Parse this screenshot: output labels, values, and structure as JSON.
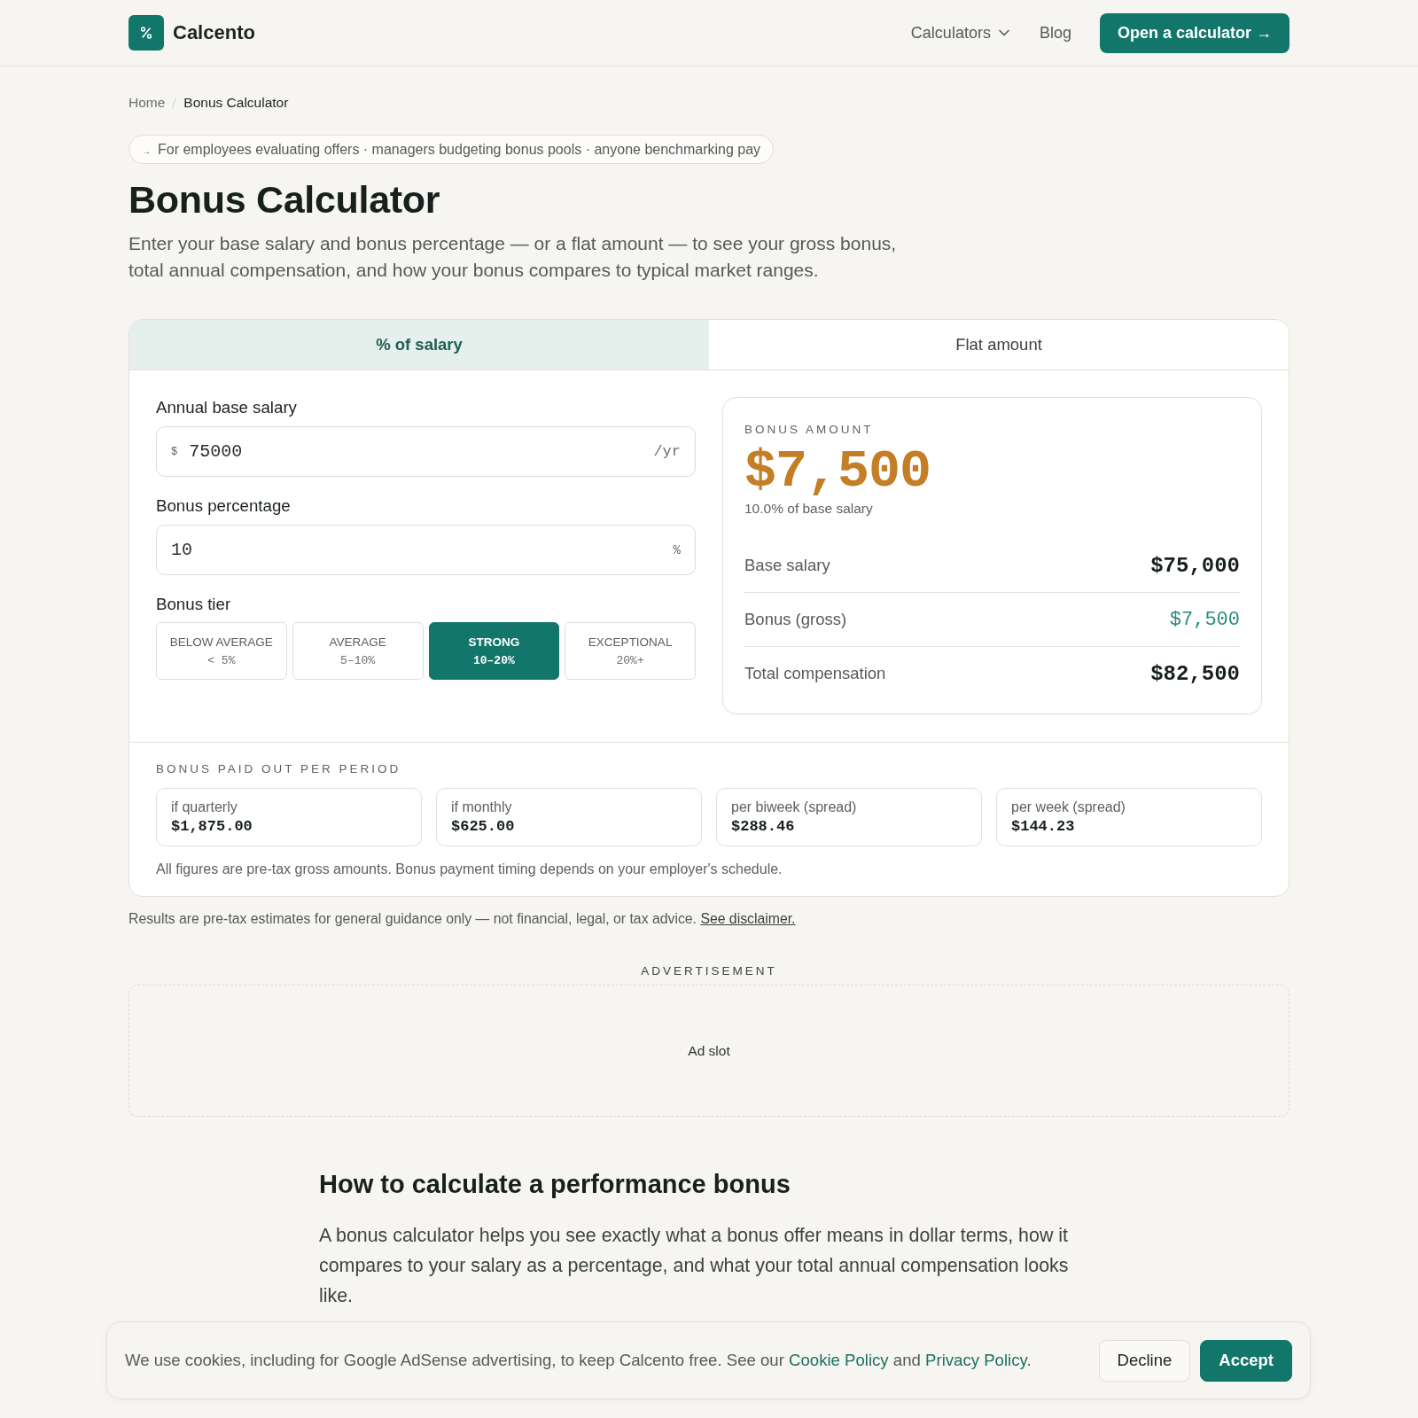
{
  "header": {
    "brand": "Calcento",
    "nav": [
      {
        "label": "Calculators",
        "kind": "dropdown"
      },
      {
        "label": "Blog",
        "kind": "link"
      }
    ],
    "cta": "Open a calculator →"
  },
  "breadcrumb": [
    {
      "label": "Home",
      "current": false
    },
    {
      "label": "Bonus Calculator",
      "current": true
    }
  ],
  "audience": {
    "marker": "→",
    "text": "For employees evaluating offers · managers budgeting bonus pools · anyone benchmarking pay"
  },
  "title": "Bonus Calculator",
  "intro": "Enter your base salary and bonus percentage — or a flat amount — to see your gross bonus, total annual compensation, and how your bonus compares to typical market ranges.",
  "calculator": {
    "tabs": [
      {
        "label": "% of salary",
        "selected": true
      },
      {
        "label": "Flat amount",
        "selected": false
      }
    ],
    "fields": [
      {
        "label": "Annual base salary",
        "prefix": "$",
        "value": "75000",
        "suffix": "/yr"
      },
      {
        "label": "Bonus percentage",
        "value": "10",
        "suffix": "%"
      }
    ],
    "tier": {
      "label": "Bonus tier",
      "options": [
        {
          "name": "BELOW AVERAGE",
          "range": "< 5%",
          "selected": false
        },
        {
          "name": "AVERAGE",
          "range": "5–10%",
          "selected": false
        },
        {
          "name": "STRONG",
          "range": "10–20%",
          "selected": true
        },
        {
          "name": "EXCEPTIONAL",
          "range": "20%+",
          "selected": false
        }
      ]
    },
    "result": {
      "heading": "BONUS AMOUNT",
      "amount": "$7,500",
      "note": "10.0% of base salary",
      "rows": [
        {
          "label": "Base salary",
          "value": "$75,000",
          "kind": "total"
        },
        {
          "label": "Bonus (gross)",
          "value": "$7,500",
          "kind": "bonus"
        },
        {
          "label": "Total compensation",
          "value": "$82,500",
          "kind": "total"
        }
      ]
    },
    "periods": {
      "heading": "BONUS PAID OUT PER PERIOD",
      "items": [
        {
          "label": "if quarterly",
          "value": "$1,875.00"
        },
        {
          "label": "if monthly",
          "value": "$625.00"
        },
        {
          "label": "per biweek (spread)",
          "value": "$288.46"
        },
        {
          "label": "per week (spread)",
          "value": "$144.23"
        }
      ]
    },
    "footnote": "All figures are pre-tax gross amounts. Bonus payment timing depends on your employer's schedule."
  },
  "disclaimer": {
    "text": "Results are pre-tax estimates for general guidance only — not financial, legal, or tax advice.",
    "link": "See disclaimer."
  },
  "advertisement": {
    "label": "ADVERTISEMENT",
    "slot": "Ad slot"
  },
  "article": {
    "heading": "How to calculate a performance bonus",
    "paragraph": "A bonus calculator helps you see exactly what a bonus offer means in dollar terms, how it compares to your salary as a percentage, and what your total annual compensation looks like."
  },
  "cookie_banner": {
    "message": [
      {
        "kind": "text",
        "text": "We use cookies, including for Google AdSense advertising, to keep Calcento free. See our "
      },
      {
        "kind": "link",
        "text": "Cookie Policy"
      },
      {
        "kind": "text",
        "text": " and "
      },
      {
        "kind": "link",
        "text": "Privacy Policy"
      },
      {
        "kind": "text",
        "text": "."
      }
    ],
    "buttons": [
      {
        "label": "Decline",
        "kind": "secondary"
      },
      {
        "label": "Accept",
        "kind": "primary"
      }
    ]
  }
}
